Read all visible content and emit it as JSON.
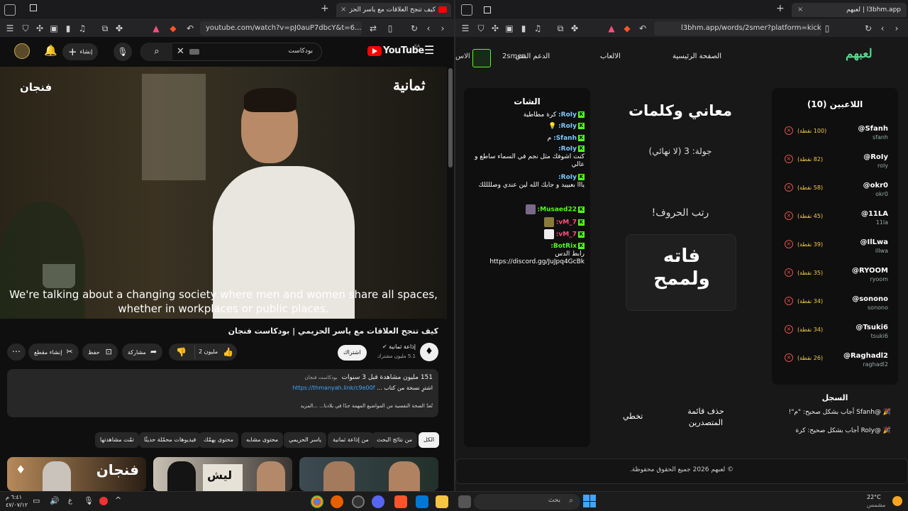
{
  "left_browser": {
    "tab_title": "كيف تنجح العلاقات مع ياسر الحز",
    "new_tab_icon": "plus-icon",
    "url": "youtube.com/watch?v=pJ0auP7dbcY&t=6...",
    "youtube": {
      "logo_text": "YouTube",
      "region": "SA",
      "search_value": "بودكاست",
      "create_label": "إنشاء",
      "video": {
        "title": "كيف تنجح العلاقات مع ياسر الحزيمي | بودكاست فنجان",
        "watermark_right": "ثمانية",
        "watermark_left": "فنجان",
        "subtitle_line1": "We're talking about a changing society where men and women share all spaces,",
        "subtitle_line2": "whether in workplaces or public places."
      },
      "channel": {
        "name": "إذاعة ثمانية",
        "subscribers": "5.1 مليون مشترك",
        "subscribe_label": "اشتراك"
      },
      "actions": {
        "likes": "2 مليون",
        "share": "مشاركة",
        "save": "حفظ",
        "clip": "إنشاء مقطع"
      },
      "description": {
        "stats": "151 مليون مشاهدة  قبل 3 سنوات",
        "tag": "بودكاست فنجان",
        "line2_link": "https://thmanyah.link/c9e00f",
        "line2_text": "اشترِ نسخة من كتاب ...",
        "line3": "تُعدّ الصحة النفسية من المواضيع المهمة جدًا في بلادنا... ...المزيد"
      },
      "chips": [
        "الكل",
        "من نتائج البحث",
        "من إذاعة ثمانية",
        "ياسر الحزيمي",
        "محتوى مشابه",
        "محتوى يهمّك",
        "فيديوهات محمّلة حديثًا",
        "تمّت مشاهدتها"
      ],
      "thumbnails": [
        {
          "label": "فنجان"
        },
        {
          "label": "ليش"
        },
        {
          "label": ""
        }
      ]
    }
  },
  "right_browser": {
    "tab_title": "لعبهم | l3bhm.app",
    "url": "l3bhm.app/words/2smer?platform=kick",
    "site": {
      "logo": "لعبهم",
      "nav": [
        "الصفحة الرئيسية",
        "الالعاب",
        "الدعم الفني"
      ],
      "user_handle": "2smer",
      "nav_cut": "الاس"
    },
    "players": {
      "title": "اللاعبين (10)",
      "list": [
        {
          "name": "@Sfanh",
          "sub": "sfanh",
          "points": "(100 نقطة)"
        },
        {
          "name": "@RoIy",
          "sub": "roly",
          "points": "(82 نقطة)"
        },
        {
          "name": "@okr0",
          "sub": "okr0",
          "points": "(58 نقطة)"
        },
        {
          "name": "@11LA",
          "sub": "11la",
          "points": "(45 نقطة)"
        },
        {
          "name": "@IlLwa",
          "sub": "illwa",
          "points": "(39 نقطة)"
        },
        {
          "name": "@RYOOM",
          "sub": "ryoom",
          "points": "(35 نقطة)"
        },
        {
          "name": "@sonono",
          "sub": "sonono",
          "points": "(34 نقطة)"
        },
        {
          "name": "@Tsuki6",
          "sub": "tsuki6",
          "points": "(34 نقطة)"
        },
        {
          "name": "@Raghadl2",
          "sub": "raghadl2",
          "points": "(26 نقطة)"
        }
      ]
    },
    "log": {
      "title": "السجل",
      "entries": [
        "🎉 @Sfanh أجاب بشكل صحيح: \"م\"!",
        "🎉 @RoIy أجاب بشكل صحيح: كرة"
      ]
    },
    "game": {
      "title": "معاني وكلمات",
      "round": "جولة: 3 (لا نهائي)",
      "instruction": "رتب الحروف!",
      "word": "فاته ولممح",
      "clear_label": "حذف قائمة المتصدرين",
      "skip_label": "تخطي"
    },
    "chat": {
      "title": "الشات",
      "messages": [
        {
          "user": "RoIy:",
          "text": "كرة مطاطية",
          "color": "#7ec8ff"
        },
        {
          "user": "RoIy:",
          "text": "💡",
          "color": "#7ec8ff"
        },
        {
          "user": "Sfanh:",
          "text": "م",
          "color": "#7ec8ff"
        },
        {
          "user": "RoIy:",
          "text": "كنت اشوفك مثل نجم في السماء ساطع و عالي",
          "color": "#7ec8ff"
        },
        {
          "user": "RoIy:",
          "text": "ياll بعيييد و جابك الله لين عندي وصللللك",
          "color": "#7ec8ff"
        },
        {
          "user": "Musaed22:",
          "text": "",
          "color": "#53fc18"
        },
        {
          "user": "vM_7:",
          "text": "",
          "color": "#ff4f7b"
        },
        {
          "user": "vM_7:",
          "text": "",
          "color": "#ff4f7b"
        },
        {
          "user": "BotRix:",
          "text": "رابط الدس https://discord.gg/JuJpq4GcBk",
          "color": "#53fc18"
        }
      ]
    },
    "footer": "© لعبهم 2026 جميع الحقوق محفوظة."
  },
  "taskbar": {
    "search_placeholder": "بحث",
    "weather_temp": "22°C",
    "weather_desc": "مشمس",
    "time": "٦:٤١ م",
    "date": "٤٧/٠٧/١٢",
    "lang": "ع"
  }
}
